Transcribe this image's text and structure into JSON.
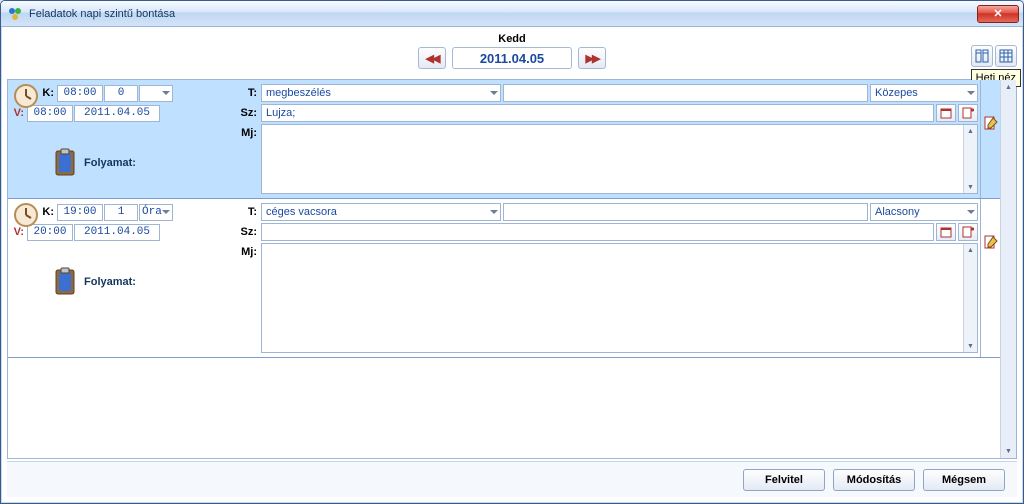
{
  "window": {
    "title": "Feladatok napi szintű bontása"
  },
  "header": {
    "day_name": "Kedd",
    "date": "2011.04.05",
    "prev_glyph": "◀◀",
    "next_glyph": "▶▶",
    "tooltip": "Heti néz"
  },
  "field_labels": {
    "K": "K:",
    "V": "V:",
    "T": "T:",
    "Sz": "Sz:",
    "Mj": "Mj:"
  },
  "process_label": "Folyamat:",
  "tasks": [
    {
      "start_time": "08:00",
      "end_time": "08:00",
      "end_date": "2011.04.05",
      "duration_value": "0",
      "duration_unit": "",
      "type": "megbeszélés",
      "priority": "Közepes",
      "sz": "Lujza;",
      "selected": true
    },
    {
      "start_time": "19:00",
      "end_time": "20:00",
      "end_date": "2011.04.05",
      "duration_value": "1",
      "duration_unit": "Óra",
      "type": "céges vacsora",
      "priority": "Alacsony",
      "sz": "",
      "selected": false
    }
  ],
  "buttons": {
    "felvitel": "Felvitel",
    "modositas": "Módosítás",
    "megsem": "Mégsem"
  }
}
